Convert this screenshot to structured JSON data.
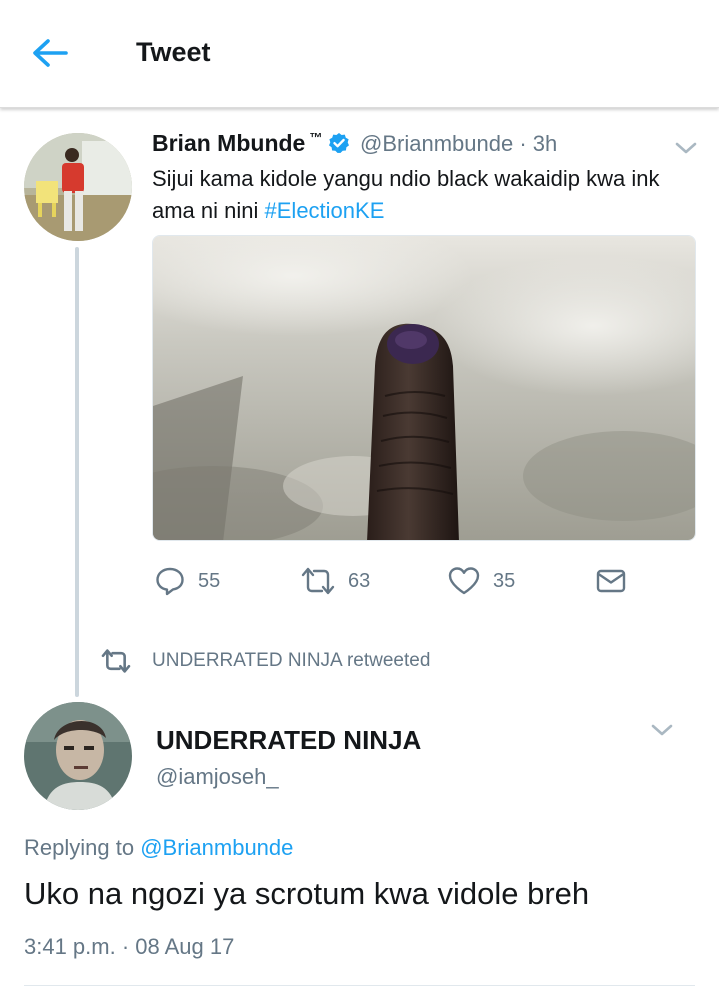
{
  "header": {
    "title": "Tweet",
    "back_icon": "arrow-left-icon",
    "accent": "#1da1f2"
  },
  "tweet": {
    "author_name": "Brian Mbunde",
    "author_tm": "™",
    "verified": true,
    "handle": "@Brianmbunde",
    "time_sep": "·",
    "time": "3h",
    "text": "Sijui kama kidole yangu ndio black wakaidip kwa ink ama ni nini ",
    "hashtag": "#ElectionKE",
    "actions": {
      "reply_count": "55",
      "retweet_count": "63",
      "like_count": "35"
    }
  },
  "retweet_context": {
    "text": "UNDERRATED NINJA retweeted"
  },
  "reply": {
    "author_name": "UNDERRATED NINJA",
    "handle": "@iamjoseh_",
    "replying_prefix": "Replying to ",
    "replying_to": "@Brianmbunde",
    "text": "Uko na ngozi ya scrotum kwa vidole breh",
    "timestamp": "3:41 p.m. · 08 Aug 17"
  },
  "colors": {
    "accent": "#1da1f2",
    "secondary_text": "#657786",
    "primary_text": "#14171a",
    "thread_line": "#ccd6dd"
  }
}
